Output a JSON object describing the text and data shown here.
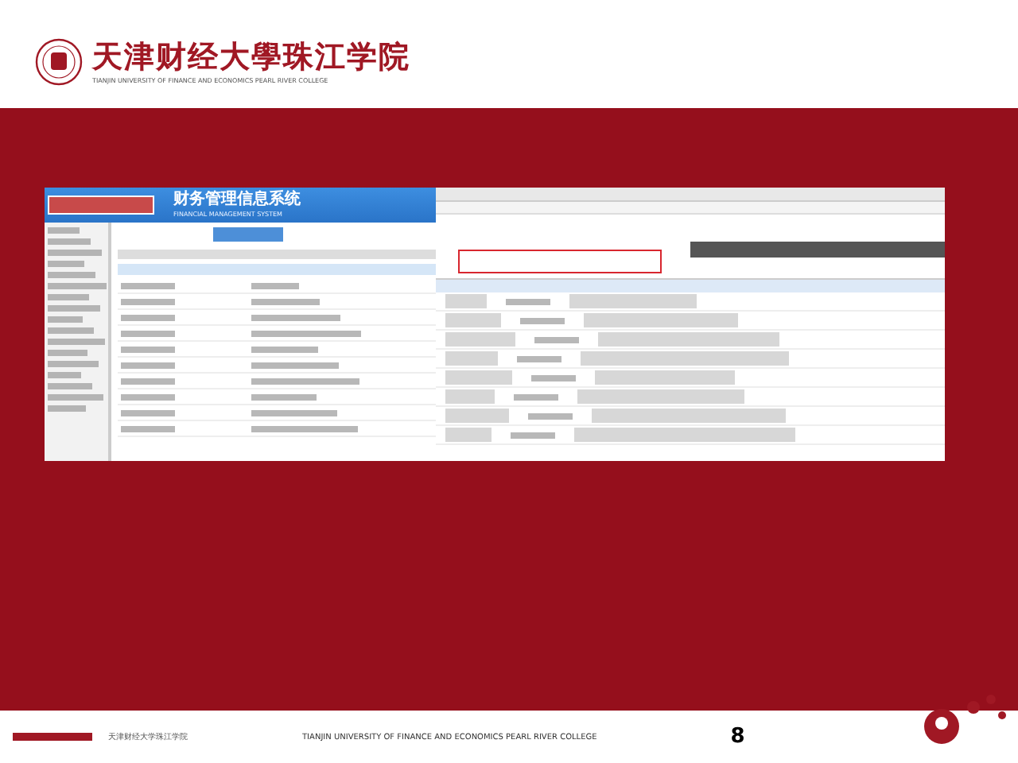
{
  "header": {
    "logo_text": "天津财经大學珠江学院",
    "logo_subtitle": "TIANJIN UNIVERSITY OF FINANCE AND ECONOMICS PEARL RIVER COLLEGE"
  },
  "screenshot_left": {
    "system_title": "财务管理信息系统",
    "system_subtitle": "FINANCIAL MANAGEMENT SYSTEM"
  },
  "footer": {
    "name_cn": "天津财经大学珠江学院",
    "name_en": "TIANJIN UNIVERSITY OF FINANCE AND ECONOMICS  PEARL RIVER COLLEGE",
    "page_number": "8"
  }
}
